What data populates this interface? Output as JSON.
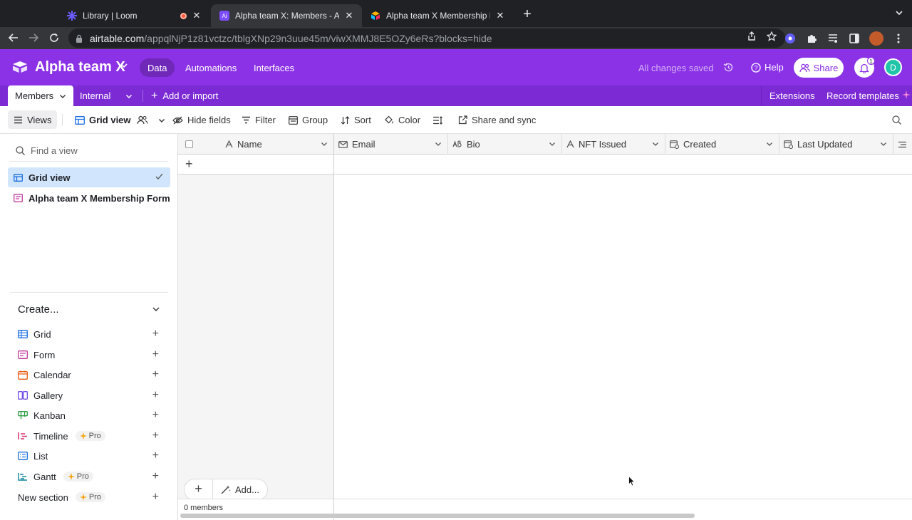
{
  "browser": {
    "tabs": [
      {
        "title": "Library | Loom"
      },
      {
        "title": "Alpha team X: Members - Airta"
      },
      {
        "title": "Alpha team X Membership Forr"
      }
    ],
    "url_host": "airtable.com",
    "url_path": "/appqlNjP1z81vctzc/tblgXNp29n3uue45m/viwXMMJ8E5OZy6eRs?blocks=hide",
    "notification_count": "1"
  },
  "header": {
    "base_name": "Alpha team X",
    "nav": [
      "Data",
      "Automations",
      "Interfaces"
    ],
    "status": "All changes saved",
    "help_label": "Help",
    "share_label": "Share",
    "avatar_letter": "D",
    "brand_color": "#8b32e6"
  },
  "tablebar": {
    "active_table": "Members",
    "other_table": "Internal",
    "add_import": "Add or import",
    "extensions": "Extensions",
    "record_templates": "Record templates"
  },
  "viewbar": {
    "views_label": "Views",
    "current_view": "Grid view",
    "hide_fields": "Hide fields",
    "filter": "Filter",
    "group": "Group",
    "sort": "Sort",
    "color": "Color",
    "share_sync": "Share and sync"
  },
  "sidebar": {
    "find_placeholder": "Find a view",
    "views": [
      {
        "label": "Grid view",
        "icon": "grid-icon",
        "selected": true
      },
      {
        "label": "Alpha team X Membership Form",
        "icon": "form-icon",
        "selected": false
      }
    ],
    "create_label": "Create...",
    "create_items": [
      {
        "label": "Grid",
        "icon": "grid-icon",
        "color": "#1d6fe0",
        "pro": ""
      },
      {
        "label": "Form",
        "icon": "form-icon",
        "color": "#c2389d",
        "pro": ""
      },
      {
        "label": "Calendar",
        "icon": "calendar-icon",
        "color": "#e8590c",
        "pro": ""
      },
      {
        "label": "Gallery",
        "icon": "gallery-icon",
        "color": "#7048e8",
        "pro": ""
      },
      {
        "label": "Kanban",
        "icon": "kanban-icon",
        "color": "#2f9e44",
        "pro": ""
      },
      {
        "label": "Timeline",
        "icon": "timeline-icon",
        "color": "#d6336c",
        "pro": "Pro"
      },
      {
        "label": "List",
        "icon": "list-icon",
        "color": "#1d6fe0",
        "pro": ""
      },
      {
        "label": "Gantt",
        "icon": "gantt-icon",
        "color": "#0c8599",
        "pro": "Pro"
      },
      {
        "label": "New section",
        "icon": "",
        "color": "#1d1f25",
        "pro": "Pro"
      }
    ]
  },
  "grid": {
    "columns": [
      "Name",
      "Email",
      "Bio",
      "NFT Issued",
      "Created",
      "Last Updated"
    ],
    "add_label": "Add...",
    "record_count": "0 members"
  }
}
